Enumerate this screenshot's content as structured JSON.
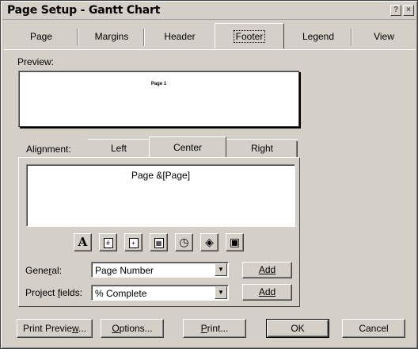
{
  "window": {
    "title": "Page Setup - Gantt Chart",
    "help_glyph": "?",
    "close_glyph": "×"
  },
  "tabs": [
    {
      "label": "Page"
    },
    {
      "label": "Margins"
    },
    {
      "label": "Header"
    },
    {
      "label": "Footer",
      "active": true
    },
    {
      "label": "Legend"
    },
    {
      "label": "View"
    }
  ],
  "preview": {
    "label": "Preview:",
    "content": "Page 1"
  },
  "alignment": {
    "label": "Alignment:",
    "tabs": [
      {
        "label": "Left"
      },
      {
        "label": "Center",
        "active": true
      },
      {
        "label": "Right"
      }
    ],
    "footer_text": "Page &[Page]"
  },
  "format_toolbar": [
    {
      "name": "font-icon",
      "glyph": "A"
    },
    {
      "name": "page-number-icon",
      "glyph": "#"
    },
    {
      "name": "total-pages-icon",
      "glyph": "+"
    },
    {
      "name": "date-icon",
      "glyph": "▦"
    },
    {
      "name": "time-icon",
      "glyph": "◷"
    },
    {
      "name": "file-name-icon",
      "glyph": "◈"
    },
    {
      "name": "picture-icon",
      "glyph": "▣"
    }
  ],
  "general": {
    "label_pre": "Gene",
    "label_u": "r",
    "label_post": "al:",
    "value": "Page Number",
    "add_label": "Add"
  },
  "project_fields": {
    "label_pre": "Project ",
    "label_u": "f",
    "label_post": "ields:",
    "value": "% Complete",
    "add_label": "Add"
  },
  "buttons": {
    "print_preview_pre": "Print Previe",
    "print_preview_u": "w",
    "print_preview_post": "...",
    "options_pre": "",
    "options_u": "O",
    "options_post": "ptions...",
    "print_pre": "",
    "print_u": "P",
    "print_post": "rint...",
    "ok": "OK",
    "cancel": "Cancel"
  }
}
